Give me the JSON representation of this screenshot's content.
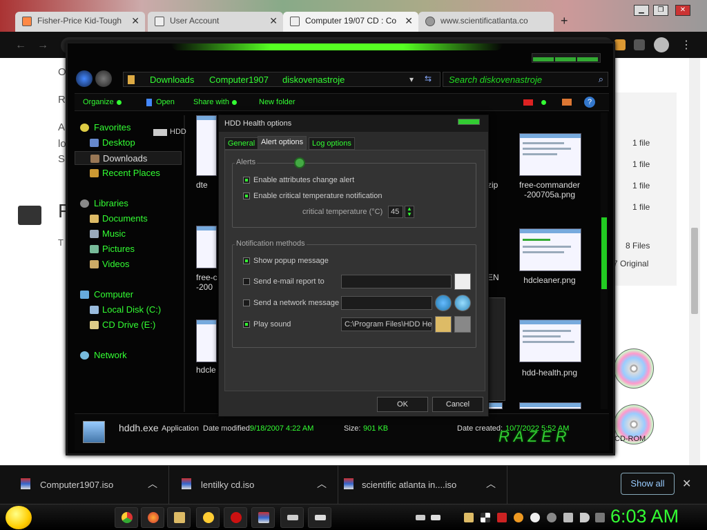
{
  "browser": {
    "tabs": [
      {
        "title": "Fisher-Price Kid-Tough"
      },
      {
        "title": "User Account"
      },
      {
        "title": "Computer 19/07 CD : Co"
      },
      {
        "title": "www.scientificatlanta.co"
      }
    ],
    "new_tab": "+",
    "window_controls": {
      "minimize": "▁",
      "restore": "❐",
      "close": "✕"
    }
  },
  "page": {
    "fragments": [
      "O",
      "R",
      "A",
      "lo",
      "S",
      "T",
      "F"
    ],
    "file_counts": [
      "1 file",
      "1 file",
      "1 file",
      "1 file"
    ],
    "summary": {
      "files": "8 Files",
      "original": "7 Original"
    },
    "cd_label": "CD-ROM"
  },
  "explorer": {
    "breadcrumb": [
      "Downloads",
      "Computer1907",
      "diskovenastroje"
    ],
    "search_placeholder": "Search diskovenastroje",
    "commands": [
      "Organize",
      "Open",
      "Share with",
      "New folder"
    ],
    "nav": {
      "favorites": {
        "label": "Favorites",
        "items": [
          "Desktop",
          "Downloads",
          "Recent Places"
        ]
      },
      "libraries": {
        "label": "Libraries",
        "items": [
          "Documents",
          "Music",
          "Pictures",
          "Videos"
        ]
      },
      "computer": {
        "label": "Computer",
        "items": [
          "Local Disk (C:)",
          "CD Drive (E:)"
        ]
      },
      "network": {
        "label": "Network"
      }
    },
    "hdd_fragment": "HDD",
    "files": [
      {
        "name": "dte"
      },
      {
        "name": "free-c\n-200"
      },
      {
        "name": "hdcle"
      },
      {
        "name": "zip"
      },
      {
        "name": "EN"
      },
      {
        "name": "free-commander\n-200705a.png"
      },
      {
        "name": "hdcleaner.png"
      },
      {
        "name": "hdd-health.png"
      }
    ],
    "details": {
      "name": "hddh.exe",
      "type": "Application",
      "modified_label": "Date modified:",
      "modified": "9/18/2007 4:22 AM",
      "size_label": "Size:",
      "size": "901 KB",
      "created_label": "Date created:",
      "created": "10/7/2022 5:52 AM",
      "brand": "RAZER"
    }
  },
  "dialog": {
    "title": "HDD Health options",
    "tabs": [
      "General",
      "Alert options",
      "Log options"
    ],
    "alerts": {
      "label": "Alerts",
      "attr_change": "Enable attributes change alert",
      "critical_temp": "Enable critical temperature notification",
      "temp_label": "critical temperature (°C)",
      "temp_value": "45"
    },
    "notify": {
      "label": "Notification methods",
      "popup": "Show popup message",
      "email": "Send e-mail report to",
      "network": "Send a network message",
      "sound": "Play sound",
      "sound_path": "C:\\Program Files\\HDD Hea"
    },
    "ok": "OK",
    "cancel": "Cancel"
  },
  "downloads": {
    "items": [
      "Computer1907.iso",
      "lentilky cd.iso",
      "scientific atlanta in....iso"
    ],
    "show_all": "Show all",
    "close": "✕"
  },
  "taskbar": {
    "clock": "6:03 AM"
  }
}
